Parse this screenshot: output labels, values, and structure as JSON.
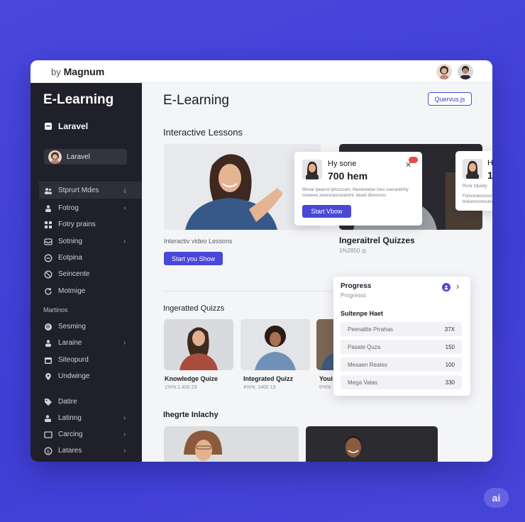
{
  "topbar": {
    "by": "by",
    "brand": "Magnum"
  },
  "sidebar": {
    "title": "E-Learning",
    "laravel_label": "Laravel",
    "user_label": "Laravel",
    "items": [
      {
        "label": "Stprurt Mdes",
        "chevron": ""
      },
      {
        "label": "Fotrog",
        "chevron": "›"
      },
      {
        "label": "Fotry prains",
        "chevron": ""
      },
      {
        "label": "Sotning",
        "chevron": "›"
      },
      {
        "label": "Eotpina",
        "chevron": ""
      },
      {
        "label": "Seincente",
        "chevron": ""
      },
      {
        "label": "Motmige",
        "chevron": ""
      }
    ],
    "section": "Martinos",
    "items2": [
      {
        "label": "Sesming",
        "chevron": ""
      },
      {
        "label": "Laraine",
        "chevron": "›"
      },
      {
        "label": "Siteopurd",
        "chevron": ""
      },
      {
        "label": "Undwinge",
        "chevron": ""
      }
    ],
    "items3": [
      {
        "label": "Datire",
        "chevron": ""
      },
      {
        "label": "Latinng",
        "chevron": "›"
      },
      {
        "label": "Carcing",
        "chevron": "›"
      },
      {
        "label": "Latares",
        "chevron": "›"
      }
    ]
  },
  "main": {
    "title": "E-Learning",
    "outline_btn": "Quervus.js",
    "lessons_heading": "Interactive Lessons",
    "lesson_caption": "Interactiv video Lessons",
    "lesson_btn": "Start you Show",
    "popup": {
      "greeting": "Hy sone",
      "big": "700 hem",
      "desc": "Mnoar Ipeanst Iprtcscuon, thesteweitar Inos ssecantinhy nisteeve zevesnasnuratstnr. beast dlvoorsns",
      "btn": "Start Vbow"
    },
    "popup2": {
      "line1": "H",
      "line2": "1",
      "desc1": "Rcnir Irjtuisty",
      "desc2": "Forlsnciesonscnu bnicemcomsutoa"
    },
    "quizzes_heading": "Ingeraitrel Quizzes",
    "quizzes_sub": "1%2850",
    "quiz_section": "Ingeratted Quizzs",
    "quizzes": [
      {
        "title": "Knowledge Quize",
        "sub": "1%%:1.400  23"
      },
      {
        "title": "Integrated Quizz",
        "sub": "4%%: 1400 13"
      },
      {
        "title": "Youi",
        "sub": "5%%"
      }
    ],
    "bottom_heading": "Ihegrte Inlachy",
    "progress": {
      "title": "Progress",
      "sub": "Progresss",
      "section": "Sultenpe Haet",
      "rows": [
        {
          "label": "Peenaltte Prrahas",
          "value": "37X"
        },
        {
          "label": "Pasate Quza",
          "value": "150"
        },
        {
          "label": "Mesaen Reates",
          "value": "100"
        },
        {
          "label": "Mega Vatas",
          "value": "330"
        }
      ]
    }
  },
  "badge": "ai"
}
